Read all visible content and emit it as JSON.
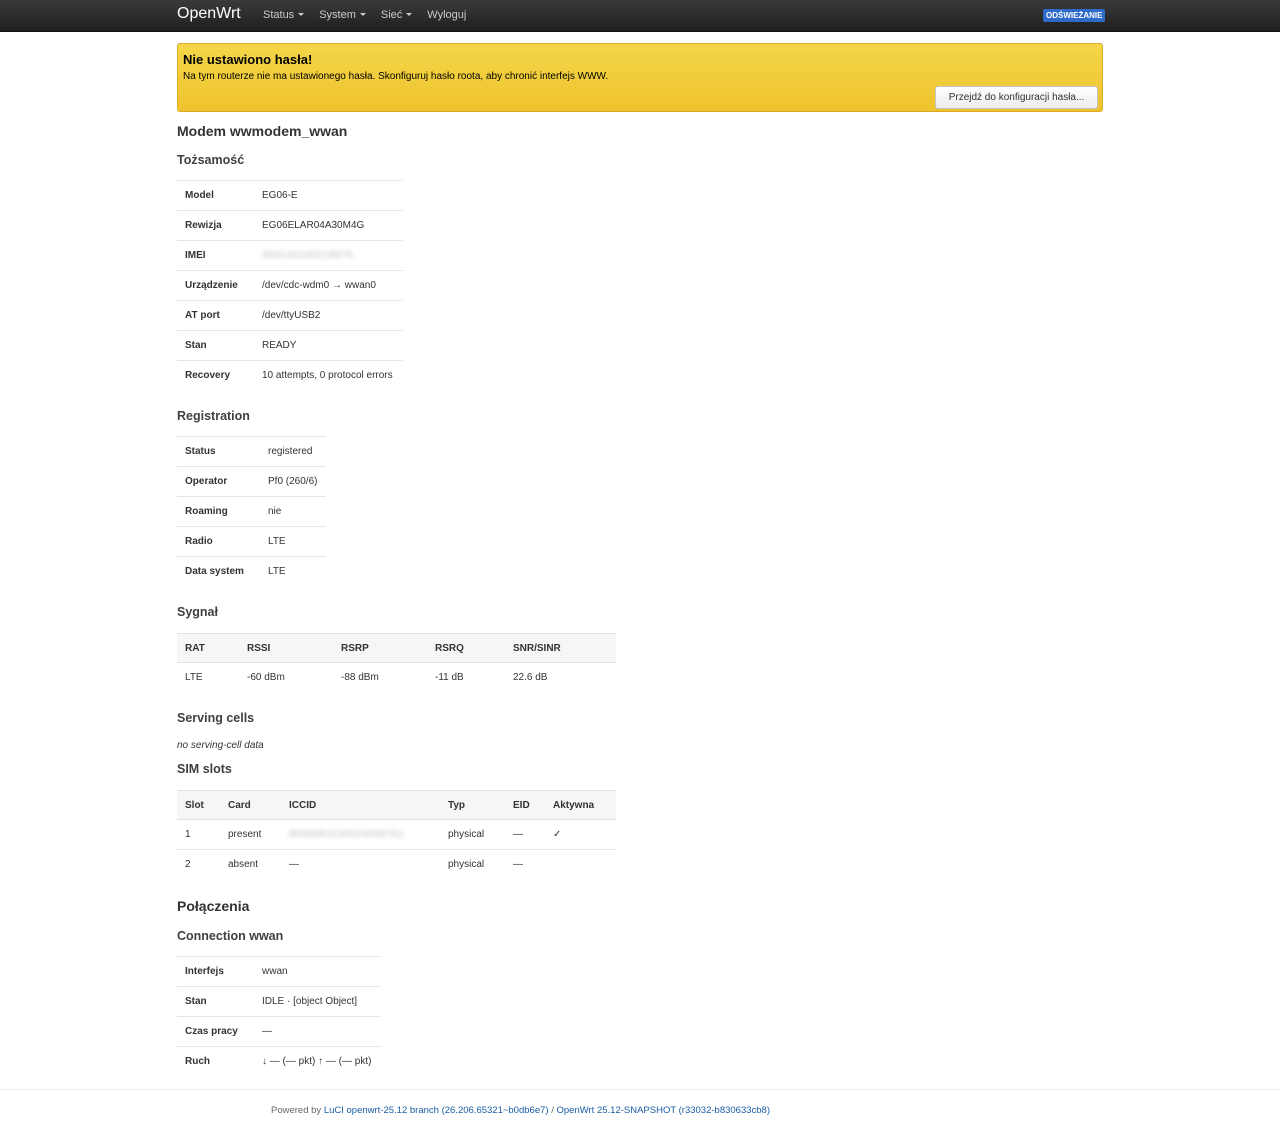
{
  "nav": {
    "brand": "OpenWrt",
    "menu": [
      {
        "label": "Status",
        "has_dropdown": true
      },
      {
        "label": "System",
        "has_dropdown": true
      },
      {
        "label": "Sieć",
        "has_dropdown": true
      },
      {
        "label": "Wyloguj",
        "has_dropdown": false
      }
    ],
    "refresh_badge": "ODŚWIEŻANIE"
  },
  "alert": {
    "title": "Nie ustawiono hasła!",
    "text": "Na tym routerze nie ma ustawionego hasła. Skonfiguruj hasło roota, aby chronić interfejs WWW.",
    "button": "Przejdź do konfiguracji hasła..."
  },
  "modem": {
    "title": "Modem wwmodem_wwan",
    "identity": {
      "heading": "Tożsamość",
      "rows": [
        {
          "key": "Model",
          "value": "EG06-E"
        },
        {
          "key": "Rewizja",
          "value": "EG06ELAR04A30M4G"
        },
        {
          "key": "IMEI",
          "value": "350143100218876"
        },
        {
          "key": "Urządzenie",
          "value": "/dev/cdc-wdm0 → wwan0"
        },
        {
          "key": "AT port",
          "value": "/dev/ttyUSB2"
        },
        {
          "key": "Stan",
          "value": "READY"
        },
        {
          "key": "Recovery",
          "value": "10 attempts, 0 protocol errors"
        }
      ]
    },
    "registration": {
      "heading": "Registration",
      "rows": [
        {
          "key": "Status",
          "value": "registered"
        },
        {
          "key": "Operator",
          "value": "Pf0 (260/6)"
        },
        {
          "key": "Roaming",
          "value": "nie"
        },
        {
          "key": "Radio",
          "value": "LTE"
        },
        {
          "key": "Data system",
          "value": "LTE"
        }
      ]
    },
    "signal": {
      "heading": "Sygnał",
      "columns": [
        "RAT",
        "RSSI",
        "RSRP",
        "RSRQ",
        "SNR/SINR"
      ],
      "rows": [
        [
          "LTE",
          "-60 dBm",
          "-88 dBm",
          "-11 dB",
          "22.6 dB"
        ]
      ]
    },
    "serving_cells": {
      "heading": "Serving cells",
      "empty_text": "no serving-cell data"
    },
    "sim_slots": {
      "heading": "SIM slots",
      "columns": [
        "Slot",
        "Card",
        "ICCID",
        "Typ",
        "EID",
        "Aktywna"
      ],
      "rows": [
        [
          "1",
          "present",
          "8948081530016068761",
          "physical",
          "—",
          "✓"
        ],
        [
          "2",
          "absent",
          "—",
          "physical",
          "—",
          ""
        ]
      ]
    }
  },
  "connections": {
    "title": "Połączenia",
    "connection": {
      "heading": "Connection wwan",
      "rows": [
        {
          "key": "Interfejs",
          "value": "wwan"
        },
        {
          "key": "Stan",
          "value": "IDLE · [object Object]"
        },
        {
          "key": "Czas pracy",
          "value": "—"
        },
        {
          "key": "Ruch",
          "value": "↓ — (— pkt) ↑ — (— pkt)"
        }
      ]
    }
  },
  "footer": {
    "prefix": "Powered by",
    "luci_link": "LuCI openwrt-25.12 branch (26.206.65321~b0db6e7)",
    "separator": "/",
    "openwrt_link": "OpenWrt 25.12-SNAPSHOT (r33032-b830633cb8)"
  }
}
